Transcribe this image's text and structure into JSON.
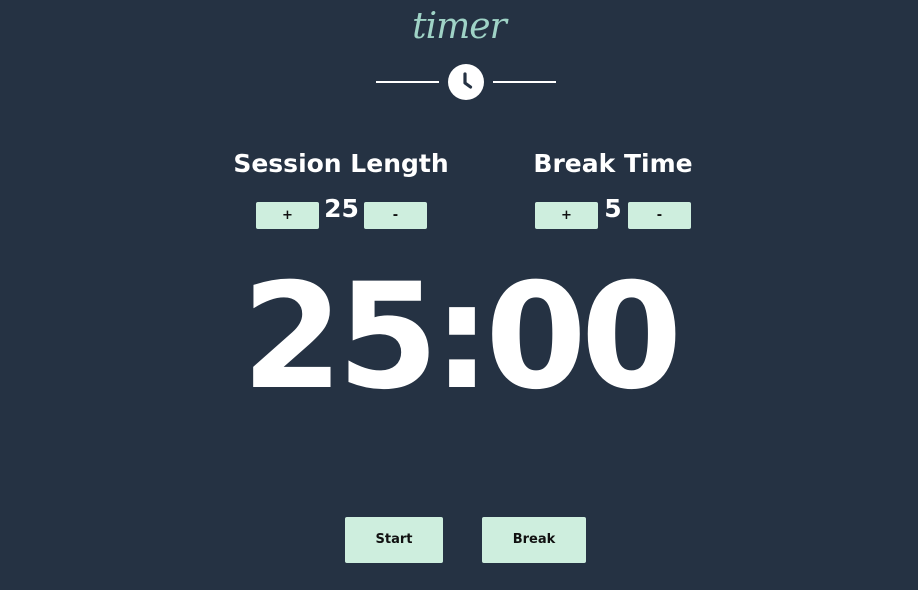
{
  "header": {
    "logo_text": "timer",
    "divider_icon": "clock-icon"
  },
  "session": {
    "title": "Session Length",
    "increment_label": "+",
    "decrement_label": "-",
    "value": "25"
  },
  "break": {
    "title": "Break Time",
    "increment_label": "+",
    "decrement_label": "-",
    "value": "5"
  },
  "timer": {
    "display": "25:00"
  },
  "controls": {
    "start_label": "Start",
    "break_label": "Break"
  },
  "colors": {
    "background": "#253243",
    "button": "#ceeede",
    "logo": "#9fd3c6",
    "text": "#ffffff"
  }
}
